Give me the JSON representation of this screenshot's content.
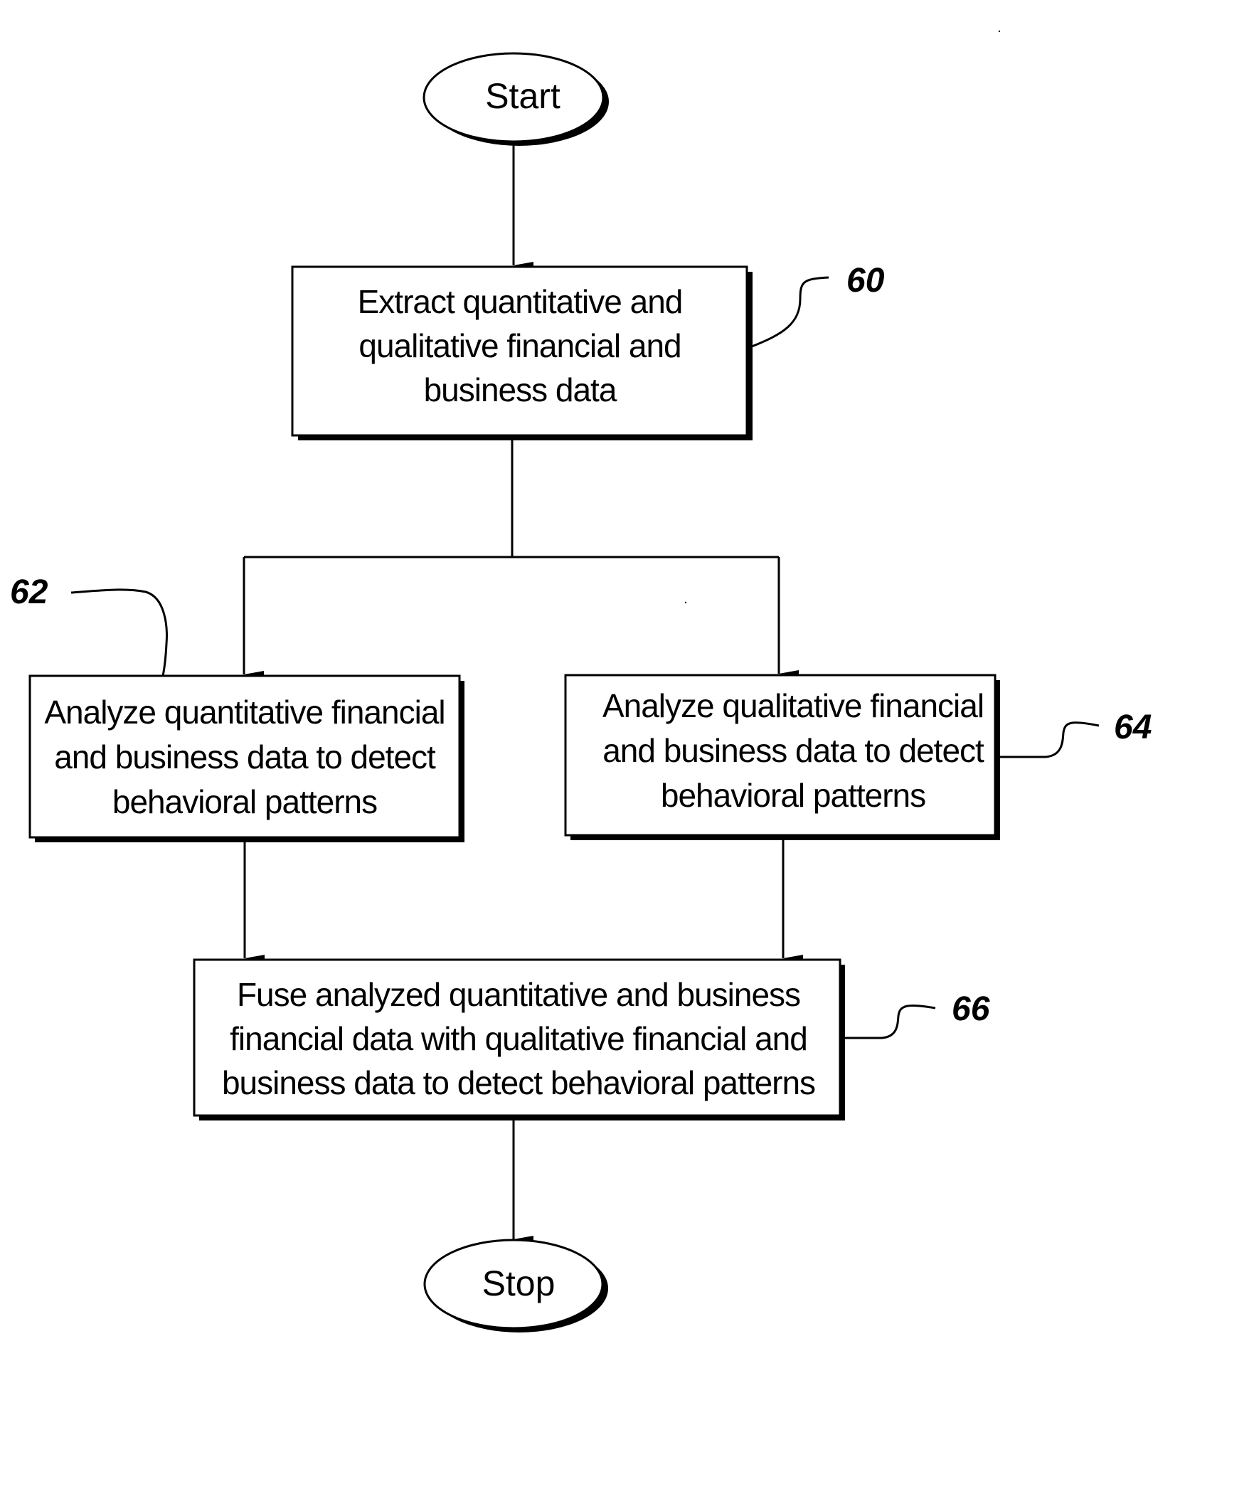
{
  "flowchart": {
    "start": {
      "label": "Start"
    },
    "stop": {
      "label": "Stop"
    },
    "steps": [
      {
        "ref": "60",
        "lines": [
          "Extract quantitative and",
          "qualitative financial and",
          "business data"
        ]
      },
      {
        "ref": "62",
        "lines": [
          "Analyze quantitative financial",
          "and business data to detect",
          "behavioral patterns"
        ]
      },
      {
        "ref": "64",
        "lines": [
          "Analyze qualitative financial",
          "and business data to detect",
          "behavioral patterns"
        ]
      },
      {
        "ref": "66",
        "lines": [
          "Fuse analyzed quantitative and business",
          "financial data with qualitative financial and",
          "business data to detect behavioral patterns"
        ]
      }
    ],
    "edges": [
      {
        "from": "Start",
        "to": "60"
      },
      {
        "from": "60",
        "to": "62"
      },
      {
        "from": "60",
        "to": "64"
      },
      {
        "from": "62",
        "to": "66"
      },
      {
        "from": "64",
        "to": "66"
      },
      {
        "from": "66",
        "to": "Stop"
      }
    ]
  }
}
